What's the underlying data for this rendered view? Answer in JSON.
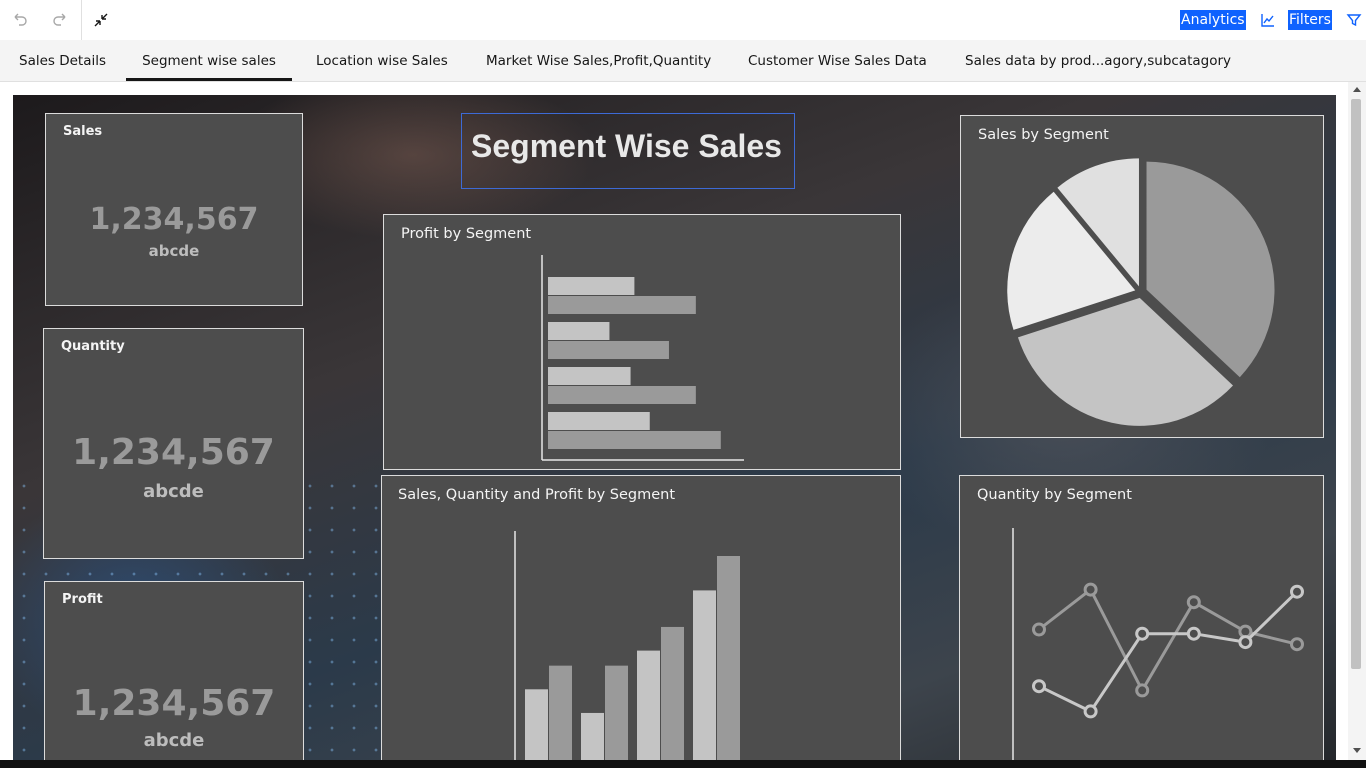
{
  "toolbar": {
    "undo_icon": "undo-icon",
    "redo_icon": "redo-icon",
    "collapse_icon": "collapse-icon",
    "analytics_label": "Analytics",
    "filters_label": "Filters",
    "accent": "#0f62fe"
  },
  "tabs": [
    {
      "label": "Sales Details"
    },
    {
      "label": "Segment wise sales"
    },
    {
      "label": "Location wise Sales"
    },
    {
      "label": "Market Wise Sales,Profit,Quantity"
    },
    {
      "label": "Customer Wise Sales Data"
    },
    {
      "label": "Sales data by prod...agory,subcatagory"
    }
  ],
  "dashboard": {
    "title": "Segment Wise Sales",
    "kpis": [
      {
        "title": "Sales",
        "value": "1,234,567",
        "sub": "abcde"
      },
      {
        "title": "Quantity",
        "value": "1,234,567",
        "sub": "abcde"
      },
      {
        "title": "Profit",
        "value": "1,234,567",
        "sub": "abcde"
      }
    ]
  },
  "chart_data": [
    {
      "type": "bar",
      "orientation": "horizontal",
      "title": "Profit by Segment",
      "xlim": [
        0,
        100
      ],
      "series": [
        {
          "values": [
            45,
            32,
            43,
            53
          ]
        },
        {
          "values": [
            77,
            63,
            77,
            90
          ]
        }
      ],
      "colors": [
        "#c4c4c4",
        "#9a9a9a"
      ]
    },
    {
      "type": "pie",
      "title": "Sales by Segment",
      "values": [
        37,
        33,
        19,
        11
      ],
      "colors": [
        "#9a9a9a",
        "#c4c4c4",
        "#ececec",
        "#e0e0e0"
      ]
    },
    {
      "type": "bar",
      "title": "Sales, Quantity and Profit by Segment",
      "ylim": [
        0,
        100
      ],
      "series": [
        {
          "values": [
            38,
            27,
            56,
            84
          ]
        },
        {
          "values": [
            49,
            49,
            67,
            100
          ]
        }
      ],
      "colors": [
        "#c4c4c4",
        "#9a9a9a"
      ]
    },
    {
      "type": "line",
      "title": "Quantity by Segment",
      "x": [
        1,
        2,
        3,
        4,
        5,
        6
      ],
      "ylim": [
        0,
        100
      ],
      "series": [
        {
          "values": [
            65,
            84,
            36,
            78,
            64,
            58
          ]
        },
        {
          "values": [
            38,
            26,
            63,
            63,
            59,
            83
          ]
        }
      ],
      "colors": [
        "#9a9a9a",
        "#c8c8c8"
      ]
    }
  ]
}
